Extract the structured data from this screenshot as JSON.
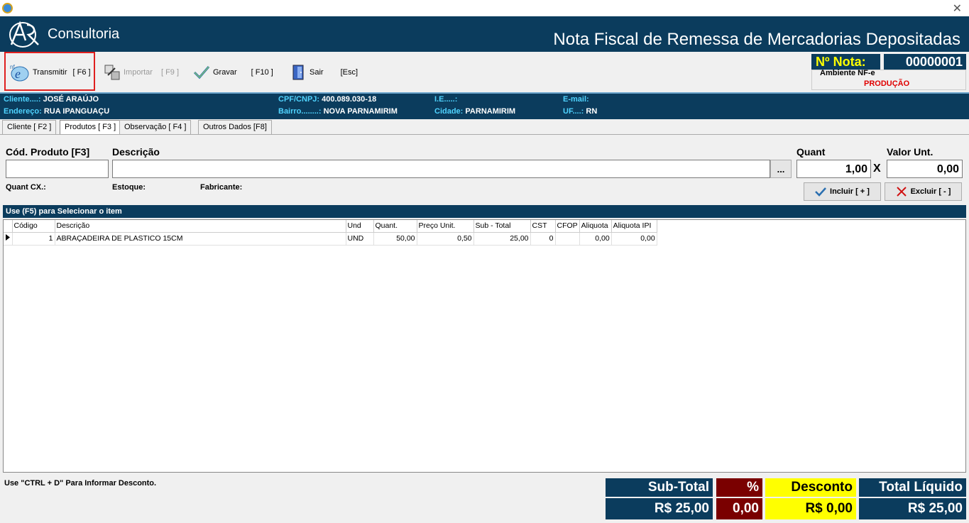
{
  "window": {
    "close_glyph": "✕"
  },
  "banner": {
    "logo_text": "Consultoria",
    "title": "Nota Fiscal de Remessa de Mercadorias Depositadas"
  },
  "toolbar": {
    "transmitir": {
      "label": "Transmitir",
      "shortcut": "[ F6 ]"
    },
    "importar": {
      "label": "Importar",
      "shortcut": "[ F9 ]"
    },
    "gravar": {
      "label": "Gravar",
      "shortcut": "[ F10 ]"
    },
    "sair": {
      "label": "Sair",
      "shortcut": "[Esc]"
    }
  },
  "nota": {
    "label": "Nº Nota:",
    "value": "00000001",
    "ambiente_label": "Ambiente NF-e",
    "ambiente_value": "PRODUÇÃO"
  },
  "cliente": {
    "cliente_k": "Cliente....:",
    "cliente_v": "JOSÉ ARAÚJO",
    "endereco_k": "Endereço:",
    "endereco_v": "RUA IPANGUAÇU",
    "cpf_k": "CPF/CNPJ:",
    "cpf_v": "400.089.030-18",
    "bairro_k": "Bairro........:",
    "bairro_v": "NOVA PARNAMIRIM",
    "ie_k": "I.E.....:",
    "ie_v": "",
    "cidade_k": "Cidade:",
    "cidade_v": "PARNAMIRIM",
    "email_k": "E-mail:",
    "email_v": "",
    "uf_k": "UF....:",
    "uf_v": "RN"
  },
  "tabs": [
    "Cliente [ F2 ]",
    "Produtos [ F3 ]",
    "Observação [ F4 ]",
    "Outros Dados [F8]"
  ],
  "form": {
    "cod_label": "Cód. Produto [F3]",
    "desc_label": "Descrição",
    "quant_label": "Quant",
    "valor_label": "Valor Unt.",
    "cod_value": "",
    "desc_value": "",
    "ellipsis": "...",
    "quant_value": "1,00",
    "times": "X",
    "valor_value": "0,00",
    "quant_cx": "Quant CX.:",
    "estoque": "Estoque:",
    "fabricante": "Fabricante:",
    "incluir": "Incluir [ + ]",
    "excluir": "Excluir [ - ]"
  },
  "grid": {
    "hint": "Use (F5) para Selecionar o item",
    "columns": [
      "Código",
      "Descrição",
      "Und",
      "Quant.",
      "Preço Unit.",
      "Sub - Total",
      "CST",
      "CFOP",
      "Aliquota",
      "Aliquota IPI"
    ],
    "rows": [
      {
        "codigo": "1",
        "descricao": "ABRAÇADEIRA DE PLASTICO 15CM",
        "und": "UND",
        "quant": "50,00",
        "preco": "0,50",
        "subtotal": "25,00",
        "cst": "0",
        "cfop": "",
        "aliquota": "0,00",
        "aliquota_ipi": "0,00"
      }
    ]
  },
  "footer": {
    "hint": "Use \"CTRL + D\" Para Informar Desconto.",
    "subtotal_label": "Sub-Total",
    "subtotal_value": "R$ 25,00",
    "pct_label": "%",
    "pct_value": "0,00",
    "desconto_label": "Desconto",
    "desconto_value": "R$ 0,00",
    "total_label": "Total Líquido",
    "total_value": "R$ 25,00"
  },
  "colors": {
    "navy": "#0b3c5d",
    "yellow": "#ffff00",
    "maroon": "#7a0000",
    "red": "#e00000"
  }
}
